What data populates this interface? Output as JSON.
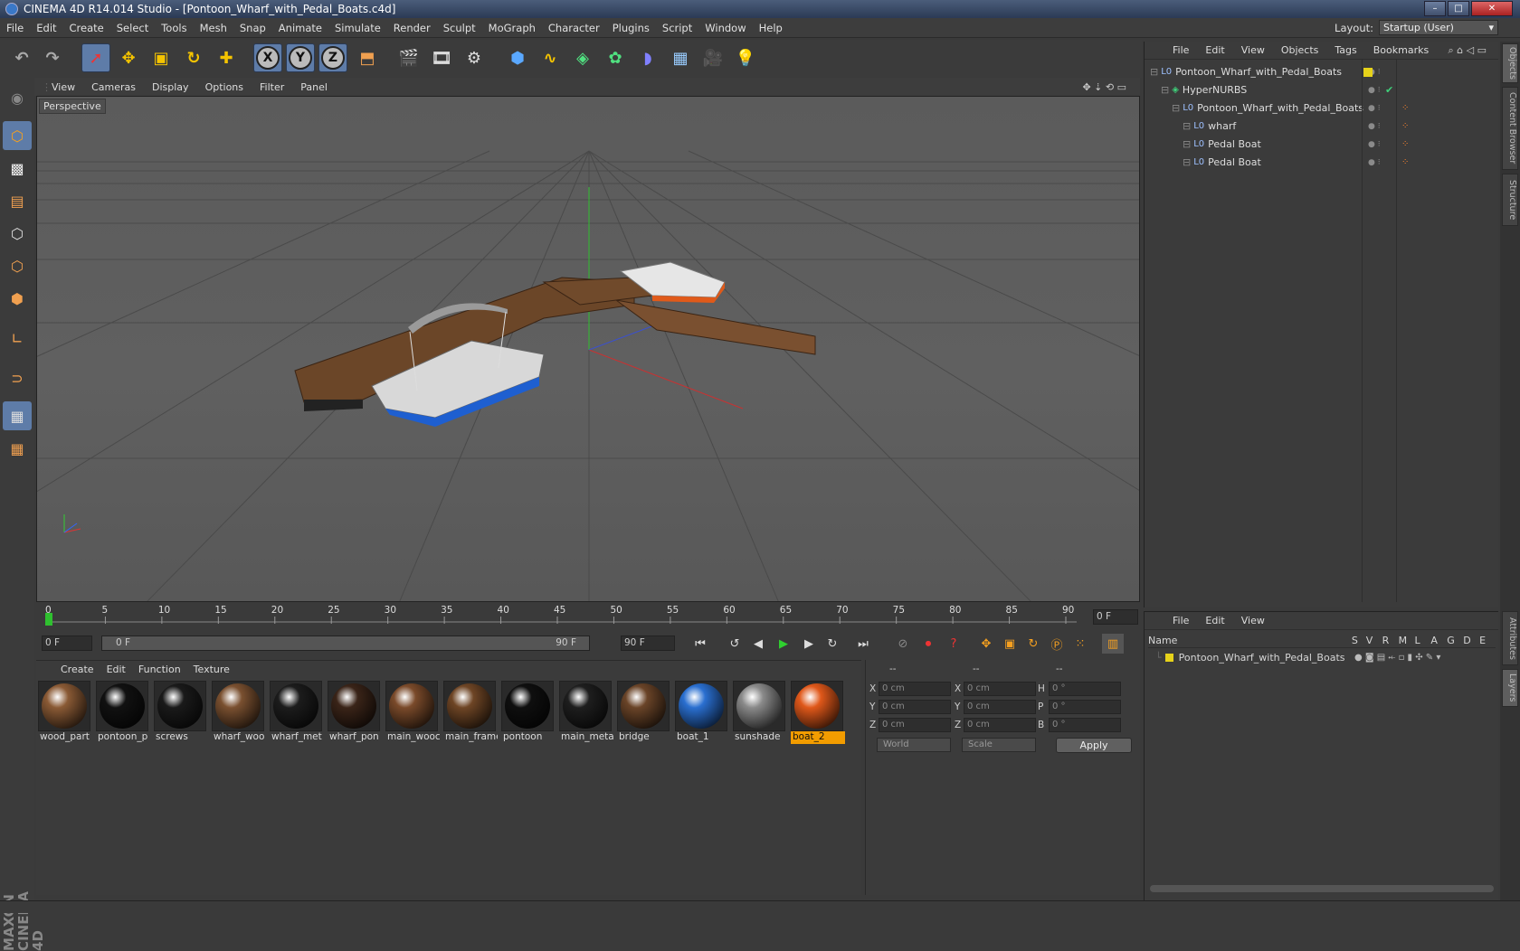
{
  "window": {
    "title": "CINEMA 4D R14.014 Studio - [Pontoon_Wharf_with_Pedal_Boats.c4d]"
  },
  "menu": [
    "File",
    "Edit",
    "Create",
    "Select",
    "Tools",
    "Mesh",
    "Snap",
    "Animate",
    "Simulate",
    "Render",
    "Sculpt",
    "MoGraph",
    "Character",
    "Plugins",
    "Script",
    "Window",
    "Help"
  ],
  "layout": {
    "label": "Layout:",
    "value": "Startup (User)"
  },
  "viewport": {
    "menu": [
      "View",
      "Cameras",
      "Display",
      "Options",
      "Filter",
      "Panel"
    ],
    "label": "Perspective"
  },
  "timeline": {
    "ticks": [
      "0",
      "5",
      "10",
      "15",
      "20",
      "25",
      "30",
      "35",
      "40",
      "45",
      "50",
      "55",
      "60",
      "65",
      "70",
      "75",
      "80",
      "85",
      "90"
    ],
    "current_frame": "0 F",
    "start": "0 F",
    "range_start": "0 F",
    "range_end": "90 F",
    "end": "90 F"
  },
  "materials": {
    "menu": [
      "Create",
      "Edit",
      "Function",
      "Texture"
    ],
    "items": [
      {
        "name": "wood_part",
        "color": "#8a5a35"
      },
      {
        "name": "pontoon_p",
        "color": "#111111"
      },
      {
        "name": "screws",
        "color": "#1a1a1a"
      },
      {
        "name": "wharf_woo",
        "color": "#7a5030"
      },
      {
        "name": "wharf_met",
        "color": "#1c1c1c"
      },
      {
        "name": "wharf_pon",
        "color": "#3a2418"
      },
      {
        "name": "main_wooc",
        "color": "#7a4a2a"
      },
      {
        "name": "main_frame",
        "color": "#6e4525"
      },
      {
        "name": "pontoon",
        "color": "#0f0f0f"
      },
      {
        "name": "main_meta",
        "color": "#1e1e1e"
      },
      {
        "name": "bridge",
        "color": "#6a4428"
      },
      {
        "name": "boat_1",
        "color": "#2a6fd0"
      },
      {
        "name": "sunshade",
        "color": "#8a8a8a"
      },
      {
        "name": "boat_2",
        "color": "#e0581a"
      }
    ],
    "selected": "boat_2"
  },
  "coords": {
    "headers": [
      "--",
      "--",
      "--"
    ],
    "rows": [
      {
        "a": "X",
        "av": "0 cm",
        "b": "X",
        "bv": "0 cm",
        "c": "H",
        "cv": "0 °"
      },
      {
        "a": "Y",
        "av": "0 cm",
        "b": "Y",
        "bv": "0 cm",
        "c": "P",
        "cv": "0 °"
      },
      {
        "a": "Z",
        "av": "0 cm",
        "b": "Z",
        "bv": "0 cm",
        "c": "B",
        "cv": "0 °"
      }
    ],
    "space": "World",
    "mode": "Scale",
    "apply": "Apply"
  },
  "objects": {
    "menu": [
      "File",
      "Edit",
      "View",
      "Objects",
      "Tags",
      "Bookmarks"
    ],
    "tree": [
      {
        "name": "Pontoon_Wharf_with_Pedal_Boats",
        "indent": 0
      },
      {
        "name": "HyperNURBS",
        "indent": 1
      },
      {
        "name": "Pontoon_Wharf_with_Pedal_Boats",
        "indent": 2
      },
      {
        "name": "wharf",
        "indent": 3
      },
      {
        "name": "Pedal Boat",
        "indent": 3
      },
      {
        "name": "Pedal Boat",
        "indent": 3
      }
    ]
  },
  "layers": {
    "menu": [
      "File",
      "Edit",
      "View"
    ],
    "columns": [
      "Name",
      "S",
      "V",
      "R",
      "M",
      "L",
      "A",
      "G",
      "D",
      "E"
    ],
    "rows": [
      "Pontoon_Wharf_with_Pedal_Boats"
    ]
  },
  "side_tabs": [
    "Objects",
    "Content Browser",
    "Structure",
    "Attributes",
    "Layers"
  ],
  "branding": "MAXON CINEMA 4D"
}
